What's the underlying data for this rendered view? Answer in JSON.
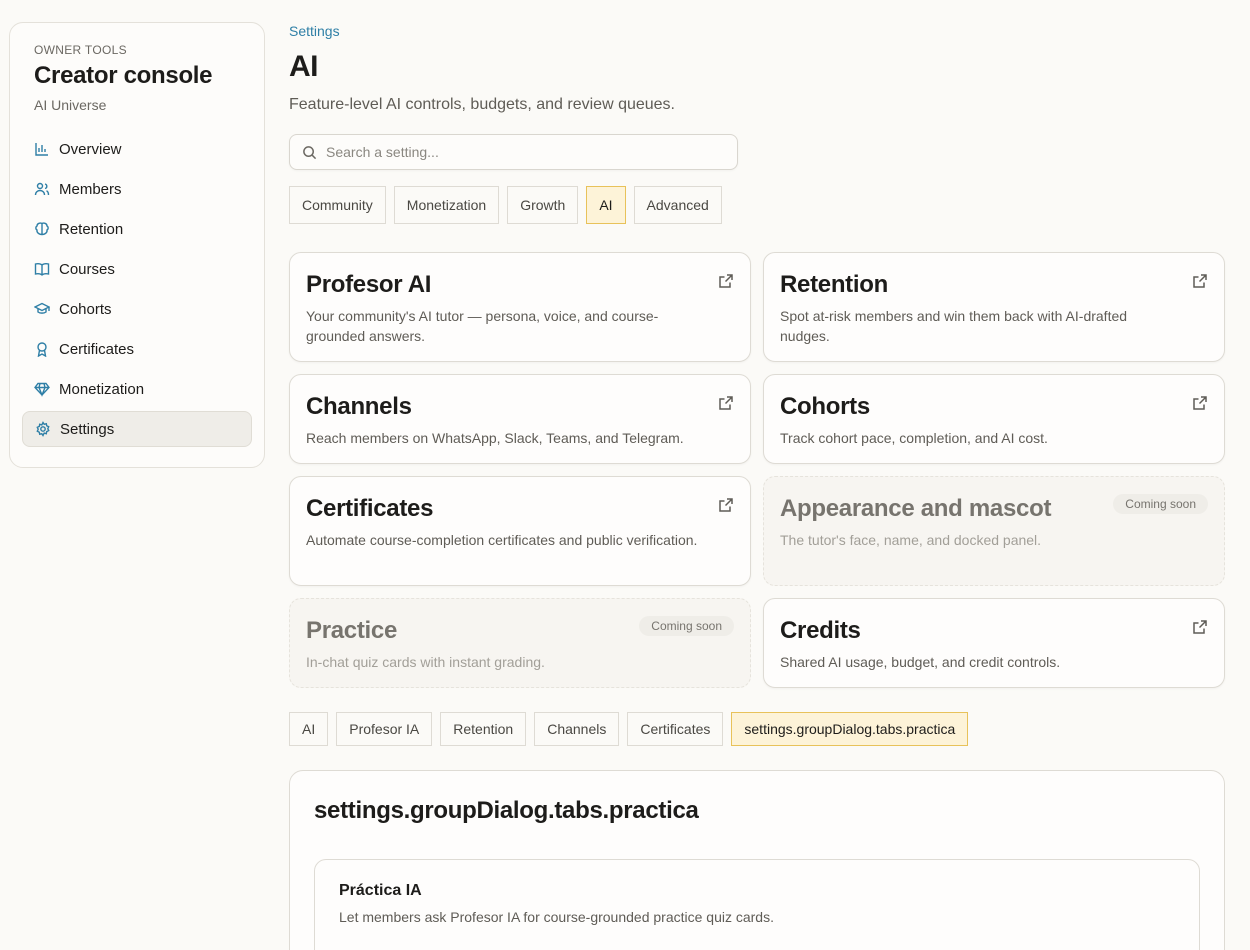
{
  "sidebar": {
    "eyebrow": "OWNER TOOLS",
    "title": "Creator console",
    "workspace": "AI Universe",
    "items": [
      {
        "label": "Overview",
        "icon": "bar-chart-icon"
      },
      {
        "label": "Members",
        "icon": "users-icon"
      },
      {
        "label": "Retention",
        "icon": "brain-icon"
      },
      {
        "label": "Courses",
        "icon": "book-icon"
      },
      {
        "label": "Cohorts",
        "icon": "graduation-cap-icon"
      },
      {
        "label": "Certificates",
        "icon": "award-icon"
      },
      {
        "label": "Monetization",
        "icon": "gem-icon"
      },
      {
        "label": "Settings",
        "icon": "gear-icon",
        "active": true
      }
    ]
  },
  "header": {
    "breadcrumb": "Settings",
    "title": "AI",
    "subtitle": "Feature-level AI controls, budgets, and review queues."
  },
  "search": {
    "placeholder": "Search a setting...",
    "value": ""
  },
  "category_tabs": [
    {
      "label": "Community"
    },
    {
      "label": "Monetization"
    },
    {
      "label": "Growth"
    },
    {
      "label": "AI",
      "active": true
    },
    {
      "label": "Advanced"
    }
  ],
  "cards": [
    {
      "title": "Profesor AI",
      "desc": "Your community's AI tutor — persona, voice, and course-grounded answers."
    },
    {
      "title": "Retention",
      "desc": "Spot at-risk members and win them back with AI-drafted nudges."
    },
    {
      "title": "Channels",
      "desc": "Reach members on WhatsApp, Slack, Teams, and Telegram."
    },
    {
      "title": "Cohorts",
      "desc": "Track cohort pace, completion, and AI cost."
    },
    {
      "title": "Certificates",
      "desc": "Automate course-completion certificates and public verification."
    },
    {
      "title": "Appearance and mascot",
      "desc": "The tutor's face, name, and docked panel.",
      "badge": "Coming soon"
    },
    {
      "title": "Practice",
      "desc": "In-chat quiz cards with instant grading.",
      "badge": "Coming soon"
    },
    {
      "title": "Credits",
      "desc": "Shared AI usage, budget, and credit controls."
    }
  ],
  "group_tabs": [
    {
      "label": "AI"
    },
    {
      "label": "Profesor IA"
    },
    {
      "label": "Retention"
    },
    {
      "label": "Channels"
    },
    {
      "label": "Certificates"
    },
    {
      "label": "settings.groupDialog.tabs.practica",
      "active": true
    }
  ],
  "group_panel": {
    "title": "settings.groupDialog.tabs.practica",
    "setting": {
      "title": "Práctica IA",
      "desc": "Let members ask Profesor IA for course-grounded practice quiz cards."
    }
  },
  "colors": {
    "accent": "#2f7fa6",
    "active_tab_bg": "#fdf3d8",
    "active_tab_border": "#e8c25a"
  }
}
